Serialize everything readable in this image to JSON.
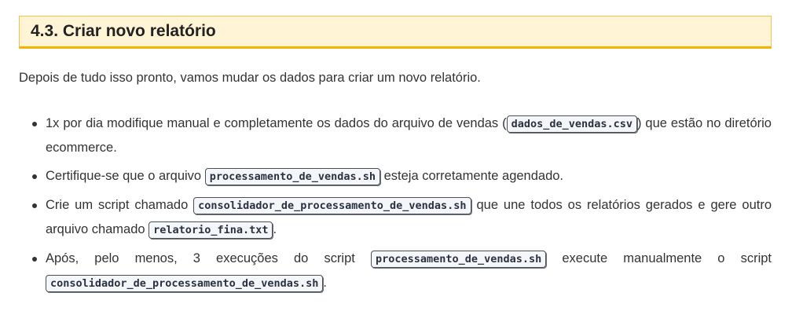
{
  "section": {
    "title": "4.3. Criar novo relatório"
  },
  "intro": "Depois de tudo isso pronto, vamos mudar os dados para criar um novo relatório.",
  "items": [
    {
      "before": "1x por dia modifique manual e completamente os dados do arquivo de vendas (",
      "code": "dados_de_vendas.csv",
      "after": ") que estão no diretório ecommerce."
    },
    {
      "before": "Certifique-se que o arquivo ",
      "code": "processamento_de_vendas.sh",
      "after": " esteja corretamente agendado."
    },
    {
      "before": "Crie um script chamado ",
      "code": "consolidador_de_processamento_de_vendas.sh",
      "middle": " que une todos os relatórios gerados e gere outro arquivo chamado ",
      "code2": "relatorio_fina.txt",
      "after": "."
    },
    {
      "before": "Após, pelo menos, 3 execuções do script ",
      "code": "processamento_de_vendas.sh",
      "middle": " execute manualmente o script ",
      "code2": "consolidador_de_processamento_de_vendas.sh",
      "after": "."
    }
  ]
}
